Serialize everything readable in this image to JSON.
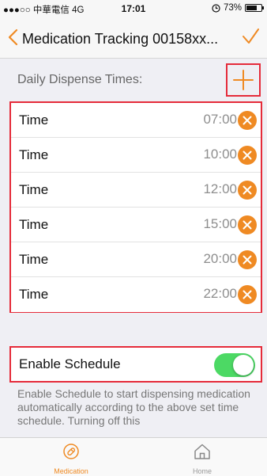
{
  "status_bar": {
    "carrier": "●●●○○ 中華電信 4G",
    "time": "17:01",
    "battery_percent": "73%",
    "battery_level": 0.73
  },
  "nav": {
    "title": "Medication Tracking 00158xx...",
    "back_icon": "chevron-left-icon",
    "confirm_icon": "checkmark-icon",
    "accent_color": "#ef8a23"
  },
  "section": {
    "title": "Daily Dispense Times:",
    "add_icon": "plus-icon"
  },
  "times": [
    {
      "label": "Time",
      "value": "07:00"
    },
    {
      "label": "Time",
      "value": "10:00"
    },
    {
      "label": "Time",
      "value": "12:00"
    },
    {
      "label": "Time",
      "value": "15:00"
    },
    {
      "label": "Time",
      "value": "20:00"
    },
    {
      "label": "Time",
      "value": "22:00"
    }
  ],
  "schedule": {
    "label": "Enable Schedule",
    "enabled": true,
    "toggle_color": "#4cd964"
  },
  "description": "Enable Schedule to start dispensing medication automatically according to the above set time schedule. Turning off this",
  "tabs": [
    {
      "label": "Medication",
      "icon": "medication-icon",
      "active": true
    },
    {
      "label": "Home",
      "icon": "home-icon",
      "active": false
    }
  ]
}
